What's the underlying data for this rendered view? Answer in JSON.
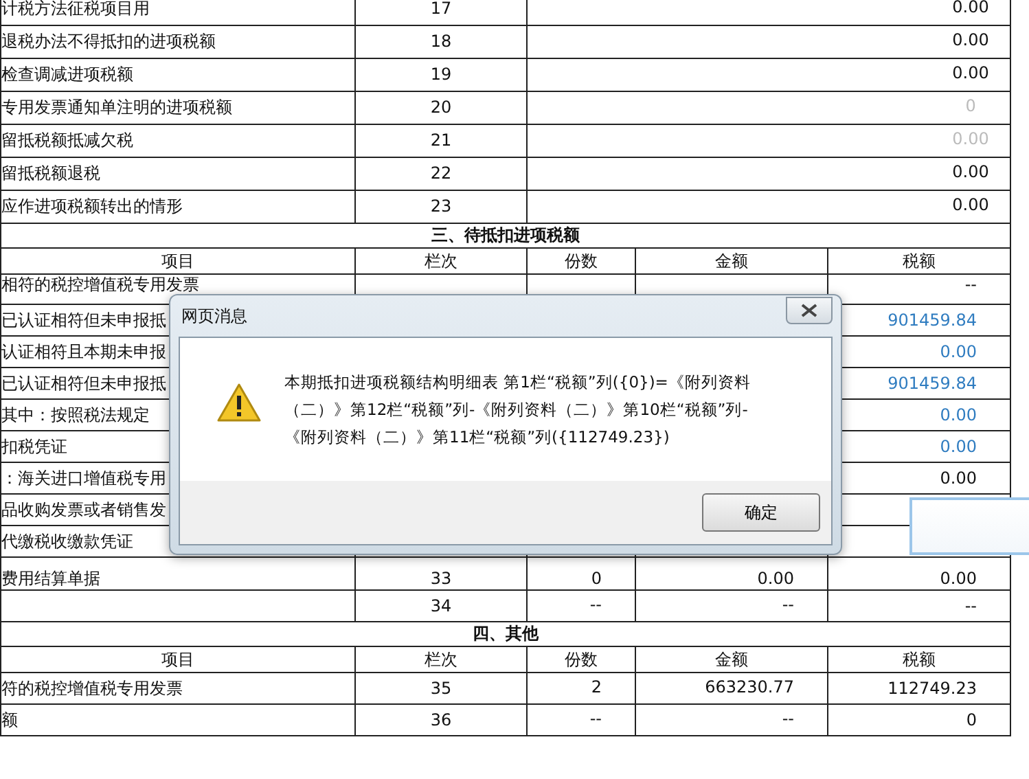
{
  "sections": [
    {
      "kind": "merged",
      "rows": [
        {
          "item": "计税方法征税项目用",
          "line": "17",
          "value": "0.00",
          "color": "#111111"
        },
        {
          "item": "退税办法不得抵扣的进项税额",
          "line": "18",
          "value": "0.00",
          "color": "#111111"
        },
        {
          "item": "检查调减进项税额",
          "line": "19",
          "value": "0.00",
          "color": "#111111"
        },
        {
          "item": "专用发票通知单注明的进项税额",
          "line": "20",
          "value": "0",
          "color": "#bbbbbb"
        },
        {
          "item": "留抵税额抵减欠税",
          "line": "21",
          "value": "0.00",
          "color": "#bbbbbb"
        },
        {
          "item": "留抵税额退税",
          "line": "22",
          "value": "0.00",
          "color": "#111111"
        },
        {
          "item": "应作进项税额转出的情形",
          "line": "23",
          "value": "0.00",
          "color": "#111111"
        }
      ]
    },
    {
      "kind": "detail",
      "title": "三、待抵扣进项税额",
      "columns": [
        "项目",
        "栏次",
        "份数",
        "金额",
        "税额"
      ],
      "rows": [
        {
          "item": "相符的税控增值税专用发票",
          "tax": "--",
          "color": "#111111",
          "kind": "raised"
        },
        {
          "item": "已认证相符但未申报抵",
          "tax": "901459.84",
          "color": "#2f7cc0"
        },
        {
          "item": "认证相符且本期未申报",
          "tax": "0.00",
          "color": "#2f7cc0"
        },
        {
          "item": "已认证相符但未申报抵",
          "tax": "901459.84",
          "color": "#2f7cc0"
        },
        {
          "item": "其中：按照税法规定",
          "tax": "0.00",
          "color": "#2f7cc0"
        },
        {
          "item": "扣税凭证",
          "tax": "0.00",
          "color": "#2f7cc0"
        },
        {
          "item": "：海关进口增值税专用",
          "tax": "0.00",
          "color": "#111111"
        },
        {
          "item": "品收购发票或者销售发"
        },
        {
          "item": "代缴税收缴款凭证"
        },
        {
          "item": "费用结算单据",
          "line": "33",
          "count": "0",
          "amount": "0.00",
          "tax": "0.00",
          "color": "#111111"
        },
        {
          "line": "34",
          "count": "--",
          "amount": "--",
          "tax": "--",
          "color": "#111111"
        }
      ]
    },
    {
      "kind": "detail",
      "title": "四、其他",
      "columns": [
        "项目",
        "栏次",
        "份数",
        "金额",
        "税额"
      ],
      "rows": [
        {
          "item": "符的税控增值税专用发票",
          "line": "35",
          "count": "2",
          "amount": "663230.77",
          "tax": "112749.23",
          "color": "#111111"
        },
        {
          "item": "额",
          "line": "36",
          "count": "--",
          "amount": "--",
          "tax": "0",
          "color": "#111111"
        }
      ]
    }
  ],
  "dialog": {
    "title": "网页消息",
    "message": "本期抵扣进项税额结构明细表 第1栏“税额”列({0})=《附列资料（二）》第12栏“税额”列-《附列资料（二）》第10栏“税额”列-《附列资料（二）》第11栏“税额”列({112749.23})",
    "button": "确定"
  }
}
